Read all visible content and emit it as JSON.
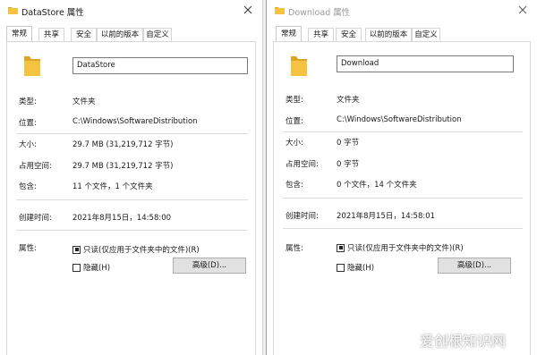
{
  "colors": {
    "folder": "#f5c242",
    "folder_dark": "#e0a424",
    "button_bg": "#e1e1e1"
  },
  "windows": [
    {
      "title": "DataStore 属性",
      "tabs": [
        "常规",
        "共享",
        "安全",
        "以前的版本",
        "自定义"
      ],
      "name": "DataStore",
      "type_label": "类型:",
      "type_value": "文件夹",
      "location_label": "位置:",
      "location_value": "C:\\Windows\\SoftwareDistribution",
      "size_label": "大小:",
      "size_value": "29.7 MB (31,219,712 字节)",
      "disk_label": "占用空间:",
      "disk_value": "29.7 MB (31,219,712 字节)",
      "contains_label": "包含:",
      "contains_value": "11 个文件，1 个文件夹",
      "created_label": "创建时间:",
      "created_value": "2021年8月15日，14:58:00",
      "attr_label": "属性:",
      "readonly_label": "只读(仅应用于文件夹中的文件)(R)",
      "hidden_label": "隐藏(H)",
      "advanced_label": "高级(D)..."
    },
    {
      "title": "Download 属性",
      "tabs": [
        "常规",
        "共享",
        "安全",
        "以前的版本",
        "自定义"
      ],
      "name": "Download",
      "type_label": "类型:",
      "type_value": "文件夹",
      "location_label": "位置:",
      "location_value": "C:\\Windows\\SoftwareDistribution",
      "size_label": "大小:",
      "size_value": "0 字节",
      "disk_label": "占用空间:",
      "disk_value": "0 字节",
      "contains_label": "包含:",
      "contains_value": "0 个文件，14 个文件夹",
      "created_label": "创建时间:",
      "created_value": "2021年8月15日，14:58:01",
      "attr_label": "属性:",
      "readonly_label": "只读(仅应用于文件夹中的文件)(R)",
      "hidden_label": "隐藏(H)",
      "advanced_label": "高级(D)..."
    }
  ],
  "watermark": "爱创根知识网"
}
